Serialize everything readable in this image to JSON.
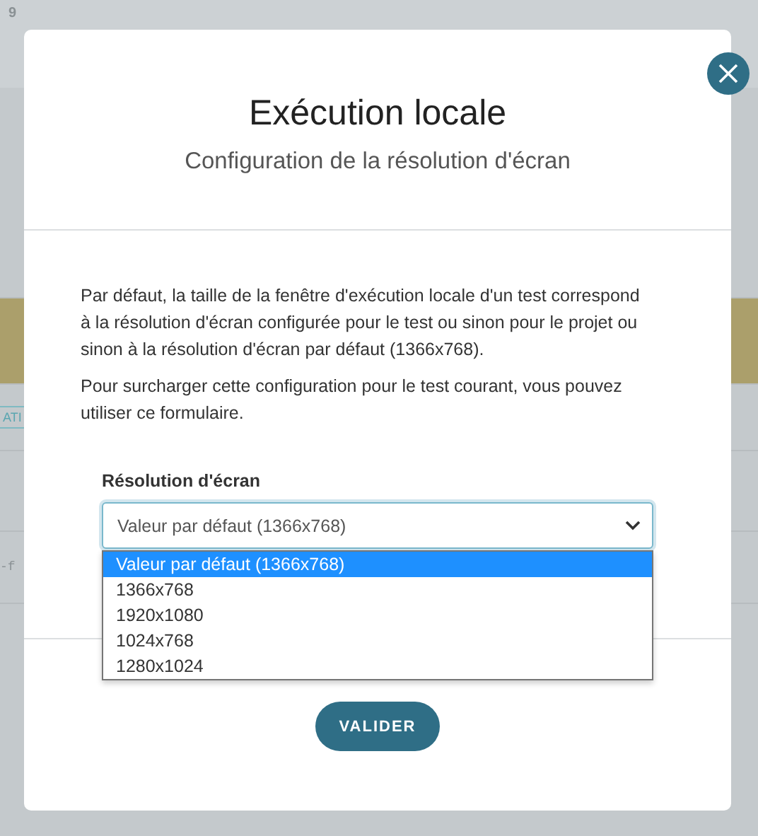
{
  "background": {
    "fragments": [
      {
        "kind": "number",
        "text": "9"
      },
      {
        "kind": "tag",
        "text": "ATI"
      },
      {
        "kind": "code",
        "text": "-f"
      }
    ]
  },
  "dialog": {
    "title": "Exécution locale",
    "subtitle": "Configuration de la résolution d'écran",
    "paragraphs": [
      "Par défaut, la taille de la fenêtre d'exécution locale d'un test correspond à la résolution d'écran configurée pour le test ou sinon pour le projet ou sinon à la résolution d'écran par défaut (1366x768).",
      "Pour surcharger cette configuration pour le test courant, vous pouvez utiliser ce formulaire."
    ],
    "field": {
      "label": "Résolution d'écran",
      "value": "Valeur par défaut (1366x768)",
      "expanded": true,
      "options": [
        {
          "label": "Valeur par défaut (1366x768)",
          "selected": true
        },
        {
          "label": "1366x768",
          "selected": false
        },
        {
          "label": "1920x1080",
          "selected": false
        },
        {
          "label": "1024x768",
          "selected": false
        },
        {
          "label": "1280x1024",
          "selected": false
        }
      ]
    },
    "submit": "VALIDER"
  }
}
